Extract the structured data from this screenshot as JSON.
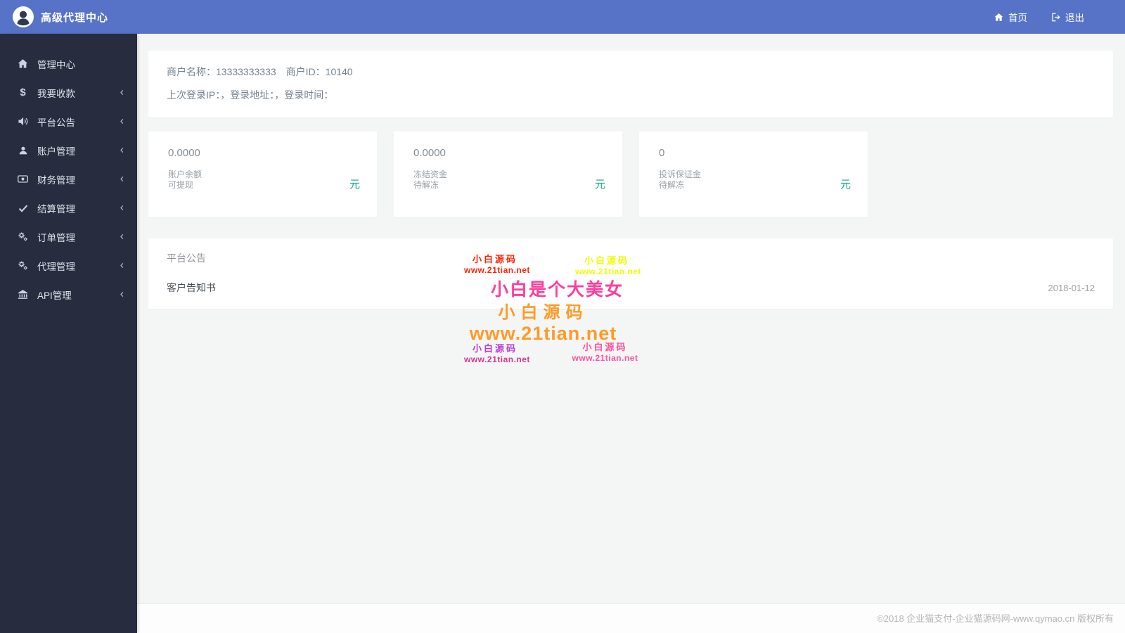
{
  "colors": {
    "header_blue": "#5673c8",
    "sidebar_dark": "#272c3e",
    "unit_teal": "#18a689"
  },
  "header": {
    "brand": "高级代理中心",
    "nav_home": "首页",
    "nav_logout": "退出"
  },
  "sidebar": {
    "items": [
      {
        "label": "管理中心",
        "icon": "home-icon"
      },
      {
        "label": "我要收款",
        "icon": "dollar-icon"
      },
      {
        "label": "平台公告",
        "icon": "bullhorn-icon"
      },
      {
        "label": "账户管理",
        "icon": "user-icon"
      },
      {
        "label": "财务管理",
        "icon": "money-icon"
      },
      {
        "label": "结算管理",
        "icon": "check-icon"
      },
      {
        "label": "订单管理",
        "icon": "cogs-icon"
      },
      {
        "label": "代理管理",
        "icon": "cogs-icon"
      },
      {
        "label": "API管理",
        "icon": "bank-icon"
      }
    ]
  },
  "merchant": {
    "name_label": "商户名称：",
    "name_value": "13333333333",
    "id_label": "商户ID：",
    "id_value": "10140",
    "login_line": "上次登录IP：，登录地址：，登录时间："
  },
  "stats": [
    {
      "value": "0.0000",
      "title": "账户余额",
      "subtitle": "可提现",
      "unit": "元"
    },
    {
      "value": "0.0000",
      "title": "冻结资金",
      "subtitle": "待解冻",
      "unit": "元"
    },
    {
      "value": "0",
      "title": "投诉保证金",
      "subtitle": "待解冻",
      "unit": "元"
    }
  ],
  "announcements": {
    "title": "平台公告",
    "items": [
      {
        "title": "客户告知书",
        "date": "2018-01-12"
      }
    ]
  },
  "watermarks": [
    {
      "lines": [
        {
          "text": "小白源码",
          "color": "#ff2400"
        },
        {
          "text": "www.21tian.net",
          "color": "#ff2400"
        }
      ]
    },
    {
      "lines": [
        {
          "text": "小白源码",
          "color": "#eeff00"
        },
        {
          "text": "www.21tian.net",
          "color": "#eeff00"
        }
      ]
    },
    {
      "lines": [
        {
          "text": "小白是个大美女",
          "color": "#ff3d9e"
        }
      ]
    },
    {
      "lines": [
        {
          "text": "小白源码",
          "color": "#ff9b26"
        },
        {
          "text": "www.21tian.net",
          "color": "#ff9b26"
        }
      ]
    },
    {
      "lines": [
        {
          "text": "小白源码",
          "color": "#bb3bd8"
        },
        {
          "text": "www.21tian.net",
          "color": "#d8388f"
        }
      ]
    },
    {
      "lines": [
        {
          "text": "小白源码",
          "color": "#ff529e"
        },
        {
          "text": "www.21tian.net",
          "color": "#ff529e"
        }
      ]
    }
  ],
  "footer": {
    "copyright": "©2018 企业猫支付-企业猫源码网-www.qymao.cn 版权所有"
  }
}
